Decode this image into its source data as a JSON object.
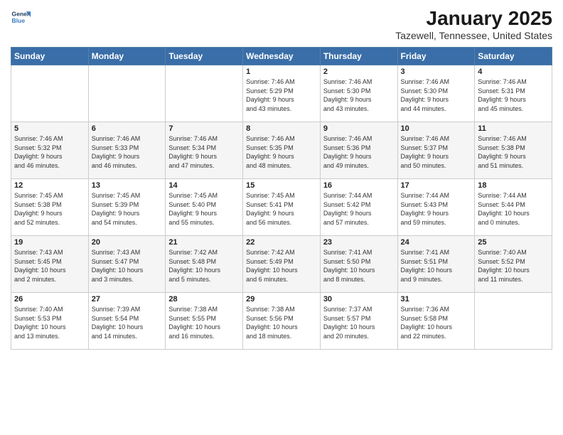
{
  "header": {
    "logo_line1": "General",
    "logo_line2": "Blue",
    "title": "January 2025",
    "subtitle": "Tazewell, Tennessee, United States"
  },
  "days_of_week": [
    "Sunday",
    "Monday",
    "Tuesday",
    "Wednesday",
    "Thursday",
    "Friday",
    "Saturday"
  ],
  "weeks": [
    [
      {
        "day": "",
        "detail": ""
      },
      {
        "day": "",
        "detail": ""
      },
      {
        "day": "",
        "detail": ""
      },
      {
        "day": "1",
        "detail": "Sunrise: 7:46 AM\nSunset: 5:29 PM\nDaylight: 9 hours\nand 43 minutes."
      },
      {
        "day": "2",
        "detail": "Sunrise: 7:46 AM\nSunset: 5:30 PM\nDaylight: 9 hours\nand 43 minutes."
      },
      {
        "day": "3",
        "detail": "Sunrise: 7:46 AM\nSunset: 5:30 PM\nDaylight: 9 hours\nand 44 minutes."
      },
      {
        "day": "4",
        "detail": "Sunrise: 7:46 AM\nSunset: 5:31 PM\nDaylight: 9 hours\nand 45 minutes."
      }
    ],
    [
      {
        "day": "5",
        "detail": "Sunrise: 7:46 AM\nSunset: 5:32 PM\nDaylight: 9 hours\nand 46 minutes."
      },
      {
        "day": "6",
        "detail": "Sunrise: 7:46 AM\nSunset: 5:33 PM\nDaylight: 9 hours\nand 46 minutes."
      },
      {
        "day": "7",
        "detail": "Sunrise: 7:46 AM\nSunset: 5:34 PM\nDaylight: 9 hours\nand 47 minutes."
      },
      {
        "day": "8",
        "detail": "Sunrise: 7:46 AM\nSunset: 5:35 PM\nDaylight: 9 hours\nand 48 minutes."
      },
      {
        "day": "9",
        "detail": "Sunrise: 7:46 AM\nSunset: 5:36 PM\nDaylight: 9 hours\nand 49 minutes."
      },
      {
        "day": "10",
        "detail": "Sunrise: 7:46 AM\nSunset: 5:37 PM\nDaylight: 9 hours\nand 50 minutes."
      },
      {
        "day": "11",
        "detail": "Sunrise: 7:46 AM\nSunset: 5:38 PM\nDaylight: 9 hours\nand 51 minutes."
      }
    ],
    [
      {
        "day": "12",
        "detail": "Sunrise: 7:45 AM\nSunset: 5:38 PM\nDaylight: 9 hours\nand 52 minutes."
      },
      {
        "day": "13",
        "detail": "Sunrise: 7:45 AM\nSunset: 5:39 PM\nDaylight: 9 hours\nand 54 minutes."
      },
      {
        "day": "14",
        "detail": "Sunrise: 7:45 AM\nSunset: 5:40 PM\nDaylight: 9 hours\nand 55 minutes."
      },
      {
        "day": "15",
        "detail": "Sunrise: 7:45 AM\nSunset: 5:41 PM\nDaylight: 9 hours\nand 56 minutes."
      },
      {
        "day": "16",
        "detail": "Sunrise: 7:44 AM\nSunset: 5:42 PM\nDaylight: 9 hours\nand 57 minutes."
      },
      {
        "day": "17",
        "detail": "Sunrise: 7:44 AM\nSunset: 5:43 PM\nDaylight: 9 hours\nand 59 minutes."
      },
      {
        "day": "18",
        "detail": "Sunrise: 7:44 AM\nSunset: 5:44 PM\nDaylight: 10 hours\nand 0 minutes."
      }
    ],
    [
      {
        "day": "19",
        "detail": "Sunrise: 7:43 AM\nSunset: 5:45 PM\nDaylight: 10 hours\nand 2 minutes."
      },
      {
        "day": "20",
        "detail": "Sunrise: 7:43 AM\nSunset: 5:47 PM\nDaylight: 10 hours\nand 3 minutes."
      },
      {
        "day": "21",
        "detail": "Sunrise: 7:42 AM\nSunset: 5:48 PM\nDaylight: 10 hours\nand 5 minutes."
      },
      {
        "day": "22",
        "detail": "Sunrise: 7:42 AM\nSunset: 5:49 PM\nDaylight: 10 hours\nand 6 minutes."
      },
      {
        "day": "23",
        "detail": "Sunrise: 7:41 AM\nSunset: 5:50 PM\nDaylight: 10 hours\nand 8 minutes."
      },
      {
        "day": "24",
        "detail": "Sunrise: 7:41 AM\nSunset: 5:51 PM\nDaylight: 10 hours\nand 9 minutes."
      },
      {
        "day": "25",
        "detail": "Sunrise: 7:40 AM\nSunset: 5:52 PM\nDaylight: 10 hours\nand 11 minutes."
      }
    ],
    [
      {
        "day": "26",
        "detail": "Sunrise: 7:40 AM\nSunset: 5:53 PM\nDaylight: 10 hours\nand 13 minutes."
      },
      {
        "day": "27",
        "detail": "Sunrise: 7:39 AM\nSunset: 5:54 PM\nDaylight: 10 hours\nand 14 minutes."
      },
      {
        "day": "28",
        "detail": "Sunrise: 7:38 AM\nSunset: 5:55 PM\nDaylight: 10 hours\nand 16 minutes."
      },
      {
        "day": "29",
        "detail": "Sunrise: 7:38 AM\nSunset: 5:56 PM\nDaylight: 10 hours\nand 18 minutes."
      },
      {
        "day": "30",
        "detail": "Sunrise: 7:37 AM\nSunset: 5:57 PM\nDaylight: 10 hours\nand 20 minutes."
      },
      {
        "day": "31",
        "detail": "Sunrise: 7:36 AM\nSunset: 5:58 PM\nDaylight: 10 hours\nand 22 minutes."
      },
      {
        "day": "",
        "detail": ""
      }
    ]
  ]
}
